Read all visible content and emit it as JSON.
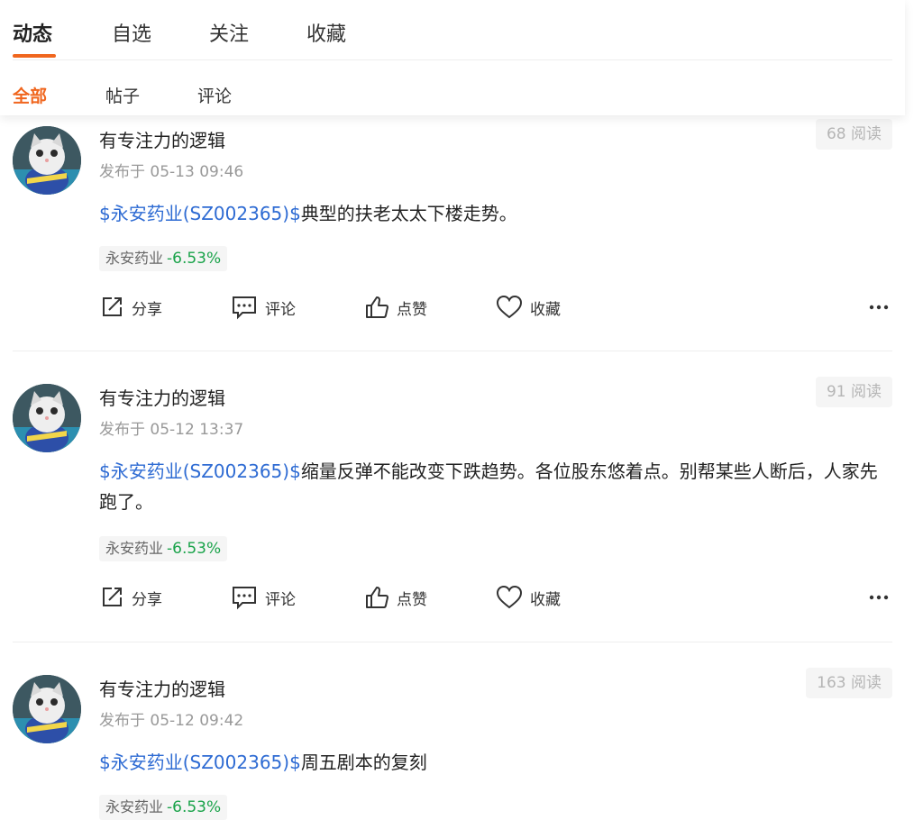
{
  "tabs": [
    {
      "label": "动态"
    },
    {
      "label": "自选"
    },
    {
      "label": "关注"
    },
    {
      "label": "收藏"
    }
  ],
  "subtabs": [
    {
      "label": "全部"
    },
    {
      "label": "帖子"
    },
    {
      "label": "评论"
    }
  ],
  "actions": {
    "share": "分享",
    "comment": "评论",
    "like": "点赞",
    "favorite": "收藏"
  },
  "posts": [
    {
      "author": "有专注力的逻辑",
      "time": "发布于 05-13 09:46",
      "reads": "68 阅读",
      "stock_link": "$永安药业(SZ002365)$",
      "text": "典型的扶老太太下楼走势。",
      "tag_name": "永安药业",
      "tag_change": "-6.53%"
    },
    {
      "author": "有专注力的逻辑",
      "time": "发布于 05-12 13:37",
      "reads": "91 阅读",
      "stock_link": "$永安药业(SZ002365)$",
      "text": "缩量反弹不能改变下跌趋势。各位股东悠着点。别帮某些人断后，人家先跑了。",
      "tag_name": "永安药业",
      "tag_change": "-6.53%"
    },
    {
      "author": "有专注力的逻辑",
      "time": "发布于 05-12 09:42",
      "reads": "163 阅读",
      "stock_link": "$永安药业(SZ002365)$",
      "text": "周五剧本的复刻",
      "tag_name": "永安药业",
      "tag_change": "-6.53%"
    }
  ],
  "colors": {
    "accent": "#f0661e",
    "link": "#2e6bd3",
    "negative_change": "#1aa34a"
  }
}
